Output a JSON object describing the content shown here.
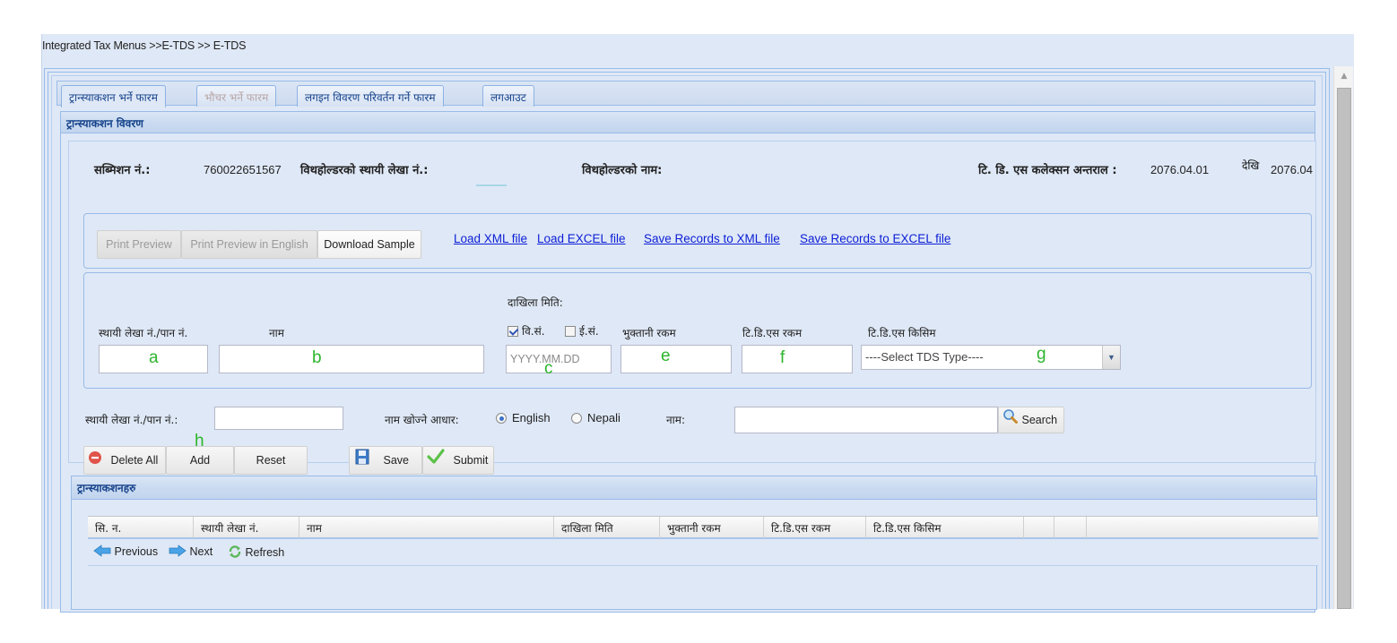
{
  "breadcrumb": "Integrated Tax Menus >>E-TDS >> E-TDS",
  "tabs": [
    {
      "label": "ट्रान्स्याकशन भर्ने फारम",
      "state": "active"
    },
    {
      "label": "भौचर भर्ने फारम",
      "state": "disabled"
    },
    {
      "label": "लगइन विवरण परिवर्तन गर्ने फारम",
      "state": "normal"
    },
    {
      "label": "लगआउट",
      "state": "normal"
    }
  ],
  "details_panel": {
    "title": "ट्रान्स्याकशन विवरण",
    "submission_label": "सब्मिशन नं.:",
    "submission_value": "760022651567",
    "withholder_pan_label": "विथहोल्डरको स्थायी लेखा नं.:",
    "withholder_pan_value": "",
    "withholder_name_label": "विथहोल्डरको नाम:",
    "withholder_name_value": "",
    "collection_interval_label": "टि. डि. एस कलेक्सन अन्तराल :",
    "interval_from": "2076.04.01",
    "from_label": "देखि",
    "interval_to": "2076.04"
  },
  "toolbar": {
    "print_preview": "Print Preview",
    "print_preview_english": "Print Preview in English",
    "download_sample": "Download Sample",
    "links": [
      "Load XML file",
      "Load EXCEL file",
      "Save Records to XML file",
      "Save Records to EXCEL file"
    ]
  },
  "entry_form": {
    "pan_label": "स्थायी लेखा नं./पान नं.",
    "name_label": "नाम",
    "date_label": "दाखिला मिति:",
    "bs_label": "वि.सं.",
    "bs_checked": true,
    "ad_label": "ई.सं.",
    "ad_checked": false,
    "date_placeholder": "YYYY.MM.DD",
    "payment_label": "भुक्तानी रकम",
    "tds_amount_label": "टि.डि.एस रकम",
    "tds_type_label": "टि.डि.एस किसिम",
    "tds_type_selected": "----Select TDS Type----",
    "markers": {
      "a": "a",
      "b": "b",
      "c": "c",
      "e": "e",
      "f": "f",
      "g": "g",
      "h": "h"
    }
  },
  "search": {
    "pan_label": "स्थायी लेखा नं./पान नं.:",
    "pan_value": "",
    "name_basis_label": "नाम खोज्ने आधार:",
    "option_english": "English",
    "option_nepali": "Nepali",
    "selected": "English",
    "name_label": "नाम:",
    "name_value": "",
    "search_button": "Search"
  },
  "actions": {
    "delete_all": "Delete All",
    "add": "Add",
    "reset": "Reset",
    "save": "Save",
    "submit": "Submit"
  },
  "transactions": {
    "title": "ट्रान्स्याकशनहरु",
    "columns": [
      "सि. न.",
      "स्थायी लेखा नं.",
      "नाम",
      "दाखिला मिति",
      "भुक्तानी रकम",
      "टि.डि.एस रकम",
      "टि.डि.एस किसिम",
      "",
      ""
    ],
    "rows": [],
    "pager": {
      "previous": "Previous",
      "next": "Next",
      "refresh": "Refresh"
    }
  }
}
